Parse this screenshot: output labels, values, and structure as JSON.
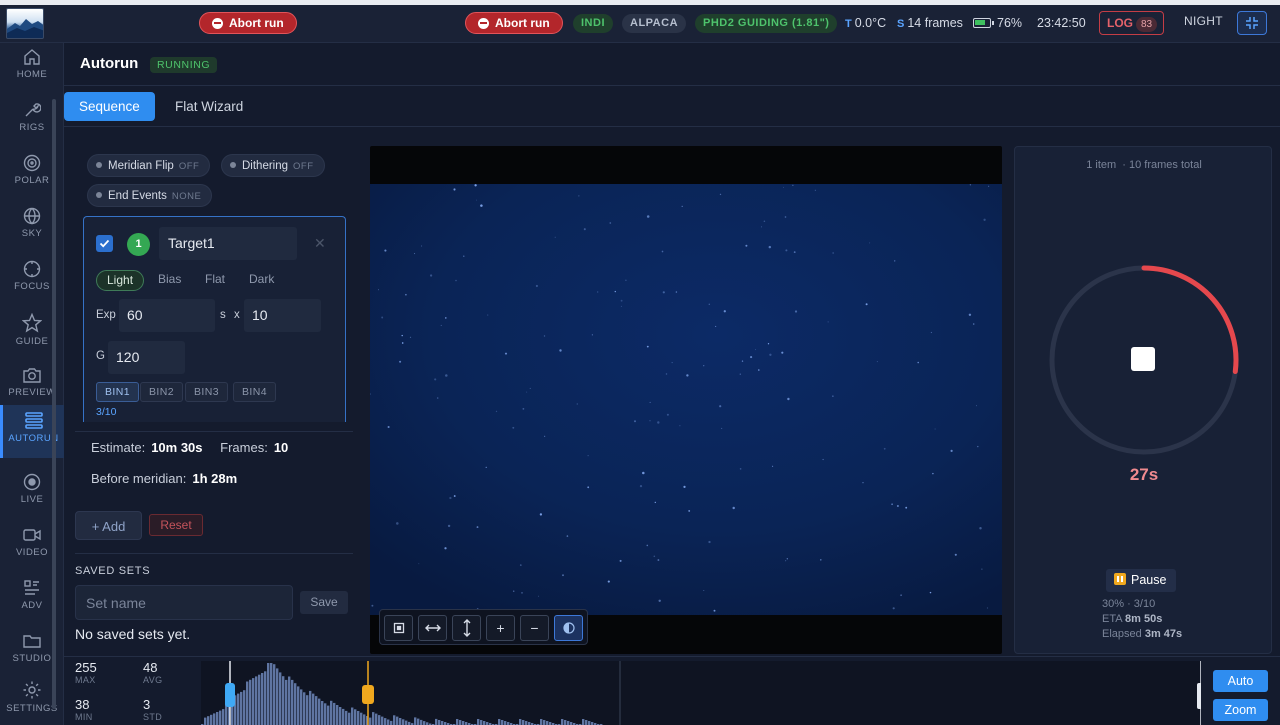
{
  "topbar": {
    "abort_label": "Abort run",
    "pills": [
      "INDI",
      "ALPACA",
      "PHD2 GUIDING (1.81\")"
    ],
    "temp_label": "T",
    "temp_value": "0.0°C",
    "frames_label": "S",
    "frames_value": "14 frames",
    "battery": "76%",
    "time": "23:42:50",
    "log_label": "LOG",
    "log_count": "83",
    "night_label": "NIGHT"
  },
  "sidebar": {
    "items": [
      {
        "label": "HOME",
        "icon": "home-icon"
      },
      {
        "label": "RIGS",
        "icon": "wrench-icon"
      },
      {
        "label": "POLAR",
        "icon": "target-icon"
      },
      {
        "label": "SKY",
        "icon": "globe-icon"
      },
      {
        "label": "FOCUS",
        "icon": "focus-icon"
      },
      {
        "label": "GUIDE",
        "icon": "star-icon"
      },
      {
        "label": "PREVIEW",
        "icon": "camera-icon"
      },
      {
        "label": "AUTORUN",
        "icon": "stack-icon"
      },
      {
        "label": "LIVE",
        "icon": "record-icon"
      },
      {
        "label": "VIDEO",
        "icon": "video-icon"
      },
      {
        "label": "ADV",
        "icon": "grid-list-icon"
      },
      {
        "label": "STUDIO",
        "icon": "folder-icon"
      },
      {
        "label": "SETTINGS",
        "icon": "gear-icon"
      }
    ],
    "active": "AUTORUN"
  },
  "page": {
    "title": "Autorun",
    "status": "RUNNING"
  },
  "tabs": [
    "Sequence",
    "Flat Wizard"
  ],
  "options": {
    "meridian_flip": {
      "label": "Meridian Flip",
      "value": "OFF"
    },
    "dithering": {
      "label": "Dithering",
      "value": "OFF"
    },
    "end_events": {
      "label": "End Events",
      "value": "NONE"
    }
  },
  "target": {
    "number": "1",
    "name": "Target1",
    "types": [
      "Light",
      "Bias",
      "Flat",
      "Dark"
    ],
    "active_type": "Light",
    "exp_label": "Exp",
    "exp": "60",
    "exp_unit": "s",
    "times": "x",
    "count": "10",
    "gain_label": "G",
    "gain": "120",
    "bins": [
      "BIN1",
      "BIN2",
      "BIN3",
      "BIN4"
    ],
    "progress": "3/10",
    "progress_fraction": 0.3
  },
  "estimate": {
    "estimate_label": "Estimate:",
    "estimate_value": "10m 30s",
    "frames_label": "Frames:",
    "frames_value": "10",
    "meridian_label": "Before meridian:",
    "meridian_value": "1h 28m"
  },
  "actions": {
    "add": "+ Add",
    "reset": "Reset"
  },
  "saved": {
    "heading": "SAVED SETS",
    "placeholder": "Set name",
    "save": "Save",
    "empty": "No saved sets yet."
  },
  "run_panel": {
    "items": "1 item",
    "frames_total": "· 10 frames total",
    "countdown": "27s",
    "pause": "Pause",
    "progress": "30% · 3/10",
    "eta_label": "ETA",
    "eta": "8m 50s",
    "elapsed_label": "Elapsed",
    "elapsed": "3m 47s",
    "ring_fraction": 0.27,
    "ring_color": "#e5484d"
  },
  "stats": {
    "max": "255",
    "max_label": "MAX",
    "avg": "48",
    "avg_label": "AVG",
    "min": "38",
    "min_label": "MIN",
    "std": "3",
    "std_label": "STD"
  },
  "histogram": {
    "auto": "Auto",
    "zoom": "Zoom"
  },
  "colors": {
    "accent": "#2f8df0",
    "danger": "#b3262b",
    "success": "#34a853"
  }
}
